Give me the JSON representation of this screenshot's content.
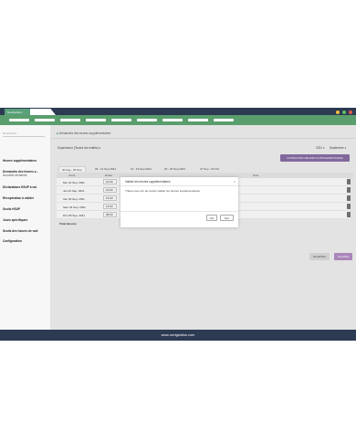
{
  "app": {
    "tab_title": "NextGestion"
  },
  "colors": {
    "titlebar": "#2c3a52",
    "menubar": "#5b9e6e",
    "accent": "#8a6fa5",
    "validate": "#b58fc6"
  },
  "sidebar": {
    "select_placeholder": "Rechercher",
    "items": [
      {
        "label": "Heures supplémentaires",
        "sub": ""
      },
      {
        "label": "Demandes des heures s...",
        "sub": "Nouvelle demande"
      },
      {
        "label": "Déclarations HSUP à val.",
        "sub": ""
      },
      {
        "label": "Récupération à valider",
        "sub": ""
      },
      {
        "label": "Seuils HSUP",
        "sub": ""
      },
      {
        "label": "Jours spécifiques",
        "sub": ""
      },
      {
        "label": "Seuils des heures de nuit",
        "sub": ""
      },
      {
        "label": "Configuration",
        "sub": ""
      }
    ]
  },
  "main": {
    "breadcrumb": "Demandes des heures supplémentaires",
    "supervisor_select": "Superviseur (Toutes les entités)",
    "year_select": "2021",
    "month_select": "Septembre",
    "consult_button": "CONSULTER HEURES SUPPLEMENTAIRES",
    "week_tabs": [
      "30 Aug - 05 Sep",
      "06 - 12 Sep 2021",
      "13 - 19 Sep 2021",
      "20 - 26 Sep 2021",
      "27 Sep - 03 Oct"
    ],
    "table_headers": {
      "day": "Jours",
      "start": "Début",
      "note": "Note"
    },
    "rows": [
      {
        "day": "Mer 01 Sep. 2021",
        "start": "10:00",
        "end": "",
        "total": ""
      },
      {
        "day": "Jeu 02 Sep. 2021",
        "start": "10:00",
        "end": "",
        "total": ""
      },
      {
        "day": "Ven 03 Sep. 2021",
        "start": "15:00",
        "end": "",
        "total": ""
      },
      {
        "day": "Sam 04 Sep. 2021",
        "start": "13:00",
        "end": "",
        "total": ""
      },
      {
        "day": "Dim 05 Sep. 2021",
        "start": "08:00",
        "end": "13:00",
        "total": "04:00"
      }
    ],
    "total_label": "Total (Hours)",
    "total_value": "13:00",
    "reject_button": "REJETER",
    "validate_button": "VALIDER"
  },
  "modal": {
    "title": "Valider les heures supplémentaires",
    "close": "×",
    "body": "Etes-vous sûr de vouloir valider les heures supplémentaires",
    "yes_button": "Oui",
    "cancel_button": "Non"
  },
  "footer": {
    "text": "www.nextgestion.com"
  }
}
